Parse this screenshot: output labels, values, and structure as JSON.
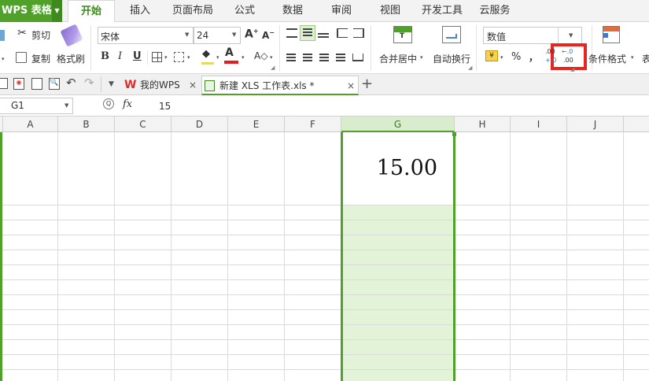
{
  "app": {
    "title": "WPS 表格"
  },
  "menu": {
    "tabs": [
      "开始",
      "插入",
      "页面布局",
      "公式",
      "数据",
      "审阅",
      "视图",
      "开发工具",
      "云服务"
    ],
    "active": "开始"
  },
  "ribbon": {
    "cut_label": "剪切",
    "copy_label": "复制",
    "format_painter_label": "格式刷",
    "font_name": "宋体",
    "font_size": "24",
    "bold": "B",
    "italic": "I",
    "underline": "U",
    "merge_label": "合并居中",
    "wrap_label": "自动换行",
    "number_format": "数值",
    "percent": "%",
    "comma": "，",
    "dec_inc_top": ".00",
    "dec_inc_bottom": "+.0",
    "dec_dec_top": "←.0",
    "dec_dec_bottom": ".00",
    "cond_format_label": "条件格式",
    "table_style_partial": "表"
  },
  "doc_tabs": [
    {
      "label": "我的WPS",
      "active": false
    },
    {
      "label": "新建 XLS 工作表.xls *",
      "active": true
    }
  ],
  "formula_bar": {
    "cell_ref": "G1",
    "fx": "fx",
    "value": "15"
  },
  "sheet": {
    "columns": [
      "A",
      "B",
      "C",
      "D",
      "E",
      "F",
      "G",
      "H",
      "I",
      "J"
    ],
    "selected_column": "G",
    "cell_g1_display": "15.00"
  },
  "colors": {
    "accent": "#4fa12a",
    "selection_fill": "#e2f3d7",
    "highlight_box": "#e8251f"
  }
}
